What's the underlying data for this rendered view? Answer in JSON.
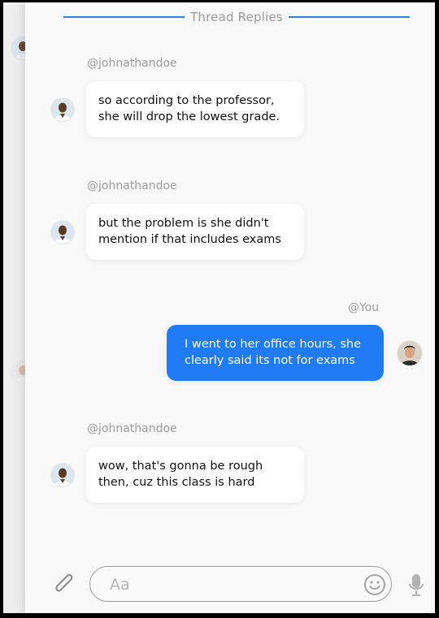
{
  "header": {
    "title": "Thread Replies"
  },
  "messages": [
    {
      "user": "@johnathandoe",
      "line1": "so according to the professor,",
      "line2": "she will drop the lowest grade."
    },
    {
      "user": "@johnathandoe",
      "line1": "but the problem is she didn't",
      "line2": "mention if that includes exams"
    },
    {
      "user": "@You",
      "line1": "I went to her office hours, she",
      "line2": "clearly said its not for exams"
    },
    {
      "user": "@johnathandoe",
      "line1": "wow, that's gonna be rough",
      "line2": "then, cuz this class is hard"
    }
  ],
  "composer": {
    "placeholder": "Aa"
  },
  "icons": {
    "attach": "paperclip-icon",
    "emoji": "smiley-icon",
    "mic": "microphone-icon"
  },
  "colors": {
    "accent": "#1f7bf6",
    "header_line": "#2a7fe0",
    "bubble": "#ffffff",
    "panel": "#f9f9f9"
  }
}
